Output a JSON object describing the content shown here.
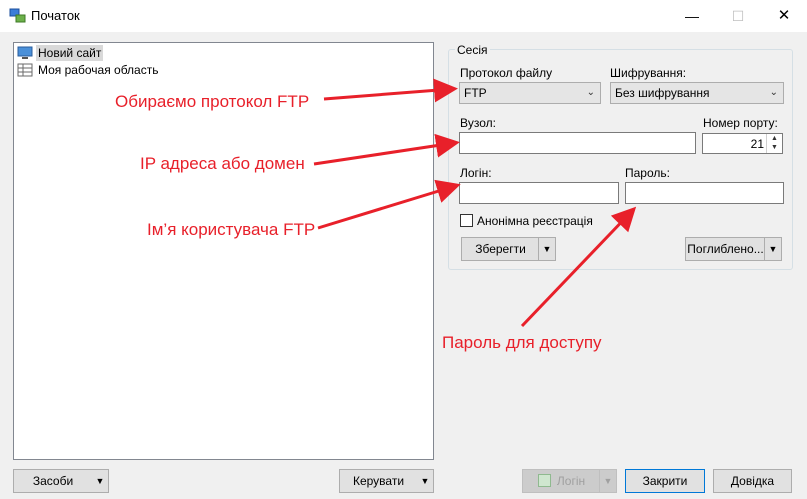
{
  "window": {
    "title": "Початок",
    "minimize": "—",
    "maximize": "☐",
    "close": "✕"
  },
  "tree": {
    "items": [
      {
        "label": "Новий сайт",
        "selected": true,
        "icon": "computer-icon"
      },
      {
        "label": "Моя рабочая область",
        "selected": false,
        "icon": "workspace-icon"
      }
    ]
  },
  "session": {
    "group_label": "Сесія",
    "protocol": {
      "label": "Протокол файлу",
      "value": "FTP"
    },
    "encryption": {
      "label": "Шифрування:",
      "value": "Без шифрування"
    },
    "host": {
      "label": "Вузол:",
      "value": ""
    },
    "port": {
      "label": "Номер порту:",
      "value": "21"
    },
    "user": {
      "label": "Логін:",
      "value": ""
    },
    "password": {
      "label": "Пароль:",
      "value": ""
    },
    "anonymous": {
      "label": "Анонімна реєстрація",
      "checked": false
    },
    "save_button": "Зберегти",
    "advanced_button": "Поглиблено..."
  },
  "footer": {
    "tools_button": "Засоби",
    "manage_button": "Керувати",
    "login_button": "Логін",
    "close_button": "Закрити",
    "help_button": "Довідка"
  },
  "annotations": {
    "protocol": "Обираємо протокол FTP",
    "host": "IP адреса або домен",
    "user": "Ім’я користувача FTP",
    "password": "Пароль для доступу",
    "color": "#e8202a"
  }
}
